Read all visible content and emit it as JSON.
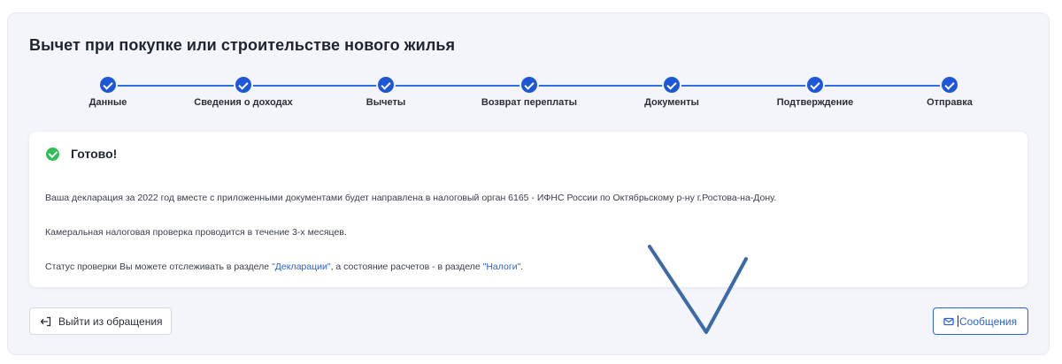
{
  "page": {
    "title": "Вычет при покупке или строительстве нового жилья"
  },
  "stepper": {
    "accent_color": "#1d56d6",
    "steps": [
      {
        "label": "Данные",
        "state": "completed"
      },
      {
        "label": "Сведения о доходах",
        "state": "completed"
      },
      {
        "label": "Вычеты",
        "state": "completed"
      },
      {
        "label": "Возврат переплаты",
        "state": "completed"
      },
      {
        "label": "Документы",
        "state": "completed"
      },
      {
        "label": "Подтверждение",
        "state": "completed"
      },
      {
        "label": "Отправка",
        "state": "current"
      }
    ]
  },
  "result": {
    "icon": "check-circle-icon",
    "status_color": "#2fbf5a",
    "title": "Готово!",
    "p1": "Ваша декларация за 2022 год вместе с приложенными документами будет направлена в налоговый орган 6165 - ИФНС России по Октябрьскому р-ну г.Ростова-на-Дону.",
    "p2": "Камеральная налоговая проверка проводится в течение 3-х месяцев.",
    "p3_before": "Статус проверки Вы можете отслеживать в разделе ",
    "p3_link1": "\"Декларации\"",
    "p3_middle": ", а состояние расчетов - в разделе ",
    "p3_link2": "\"Налоги\"",
    "p3_after": "."
  },
  "actions": {
    "exit_icon": "exit-icon",
    "exit_label": "Выйти из обращения",
    "messages_icon": "mail-icon",
    "messages_label": "Сообщения"
  },
  "annotation": {
    "shape": "checkmark-stroke",
    "color": "#3b6aa8"
  }
}
